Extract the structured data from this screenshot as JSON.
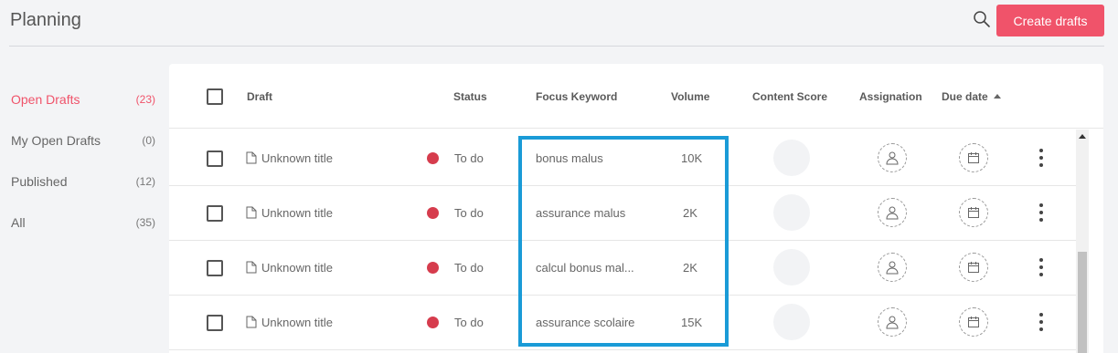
{
  "header": {
    "title": "Planning",
    "create_label": "Create drafts"
  },
  "sidebar": {
    "items": [
      {
        "label": "Open Drafts",
        "count": "(23)"
      },
      {
        "label": "My Open Drafts",
        "count": "(0)"
      },
      {
        "label": "Published",
        "count": "(12)"
      },
      {
        "label": "All",
        "count": "(35)"
      }
    ]
  },
  "table": {
    "columns": {
      "draft": "Draft",
      "status": "Status",
      "keyword": "Focus Keyword",
      "volume": "Volume",
      "score": "Content Score",
      "assignation": "Assignation",
      "due": "Due date"
    },
    "rows": [
      {
        "title": "Unknown title",
        "status": "To do",
        "keyword": "bonus malus",
        "volume": "10K"
      },
      {
        "title": "Unknown title",
        "status": "To do",
        "keyword": "assurance malus",
        "volume": "2K"
      },
      {
        "title": "Unknown title",
        "status": "To do",
        "keyword": "calcul bonus mal...",
        "volume": "2K"
      },
      {
        "title": "Unknown title",
        "status": "To do",
        "keyword": "assurance scolaire",
        "volume": "15K"
      }
    ]
  },
  "colors": {
    "accent": "#f0536a",
    "status_todo": "#d63c4d",
    "highlight": "#1a9bd7"
  },
  "icons": {
    "search": "search-icon",
    "document": "document-icon",
    "user": "user-icon",
    "calendar": "calendar-icon",
    "more": "more-vertical-icon"
  }
}
